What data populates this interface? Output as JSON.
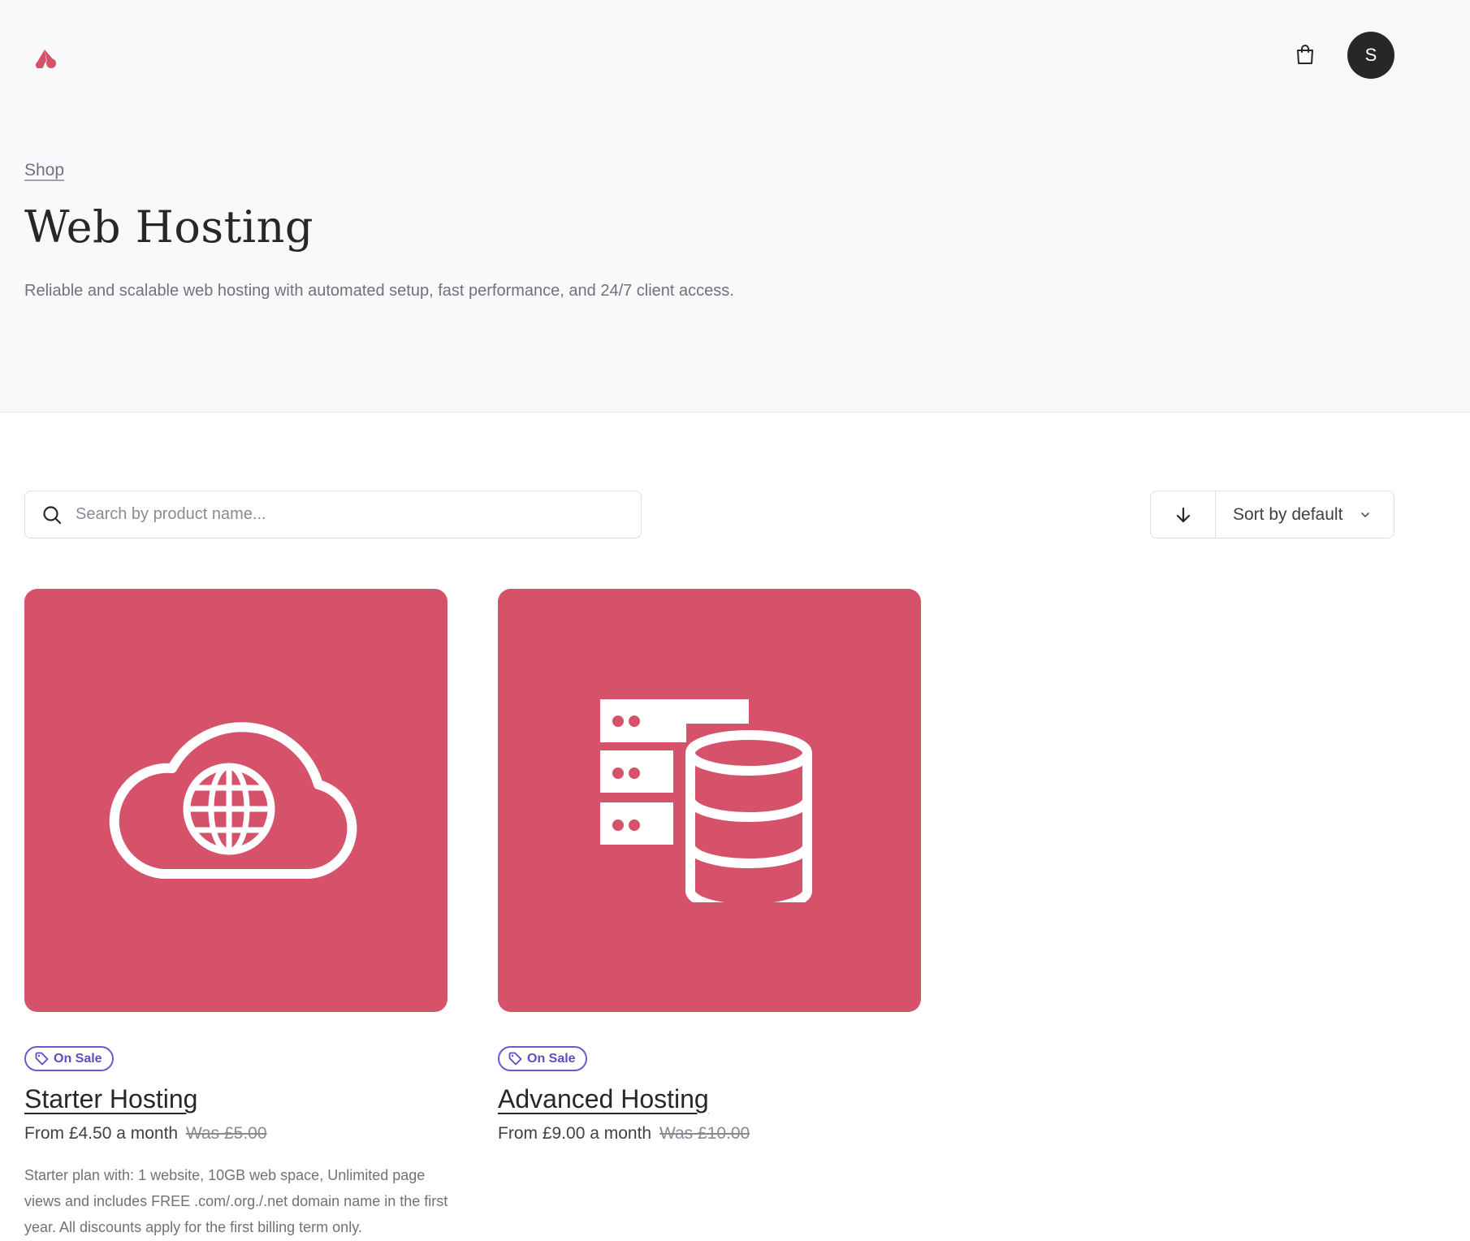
{
  "header": {
    "logo_icon": "brand-logo-icon",
    "cart_icon": "shopping-bag-icon",
    "avatar_initial": "S"
  },
  "breadcrumb": {
    "label": "Shop"
  },
  "page": {
    "title": "Web Hosting",
    "description": "Reliable and scalable web hosting with automated setup, fast performance, and 24/7 client access."
  },
  "search": {
    "placeholder": "Search by product name...",
    "value": "",
    "icon": "search-icon"
  },
  "sort": {
    "direction_icon": "arrow-down-icon",
    "selected": "Sort by default",
    "chevron_icon": "chevron-down-icon"
  },
  "products": [
    {
      "image_icon": "cloud-globe-icon",
      "badge": "On Sale",
      "name": "Starter Hosting",
      "price": "From £4.50 a month",
      "was_price": "Was £5.00",
      "description": "Starter plan with: 1 website, 10GB web space, Unlimited page views and includes FREE .com/.org./.net domain name in the first year. All discounts apply for the first billing term only."
    },
    {
      "image_icon": "server-database-icon",
      "badge": "On Sale",
      "name": "Advanced Hosting",
      "price": "From £9.00 a month",
      "was_price": "Was £10.00",
      "description": ""
    }
  ],
  "colors": {
    "accent": "#d5526a",
    "badge": "#6b5bd2",
    "hero_background": "#f9f9fb",
    "text": "#27272a"
  }
}
